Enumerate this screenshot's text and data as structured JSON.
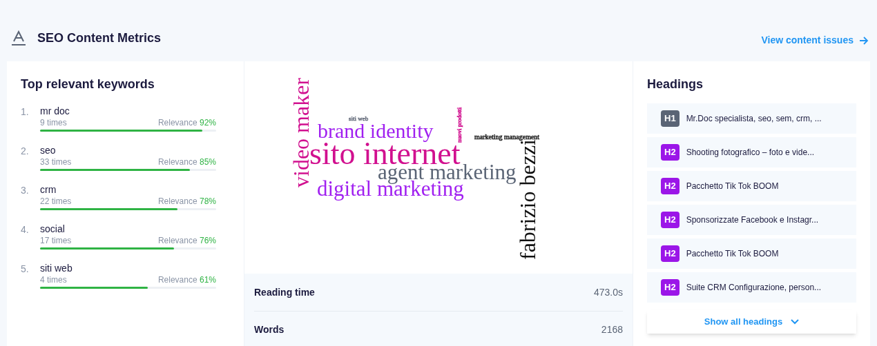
{
  "header": {
    "title": "SEO Content Metrics",
    "link": "View content issues"
  },
  "keywords": {
    "title": "Top relevant keywords",
    "items": [
      {
        "rank": "1.",
        "word": "mr doc",
        "count": "9 times",
        "label": "Relevance",
        "percent": "92%",
        "level": 0.92
      },
      {
        "rank": "2.",
        "word": "seo",
        "count": "33 times",
        "label": "Relevance",
        "percent": "85%",
        "level": 0.85
      },
      {
        "rank": "3.",
        "word": "crm",
        "count": "22 times",
        "label": "Relevance",
        "percent": "78%",
        "level": 0.78
      },
      {
        "rank": "4.",
        "word": "social",
        "count": "17 times",
        "label": "Relevance",
        "percent": "76%",
        "level": 0.76
      },
      {
        "rank": "5.",
        "word": "siti web",
        "count": "4 times",
        "label": "Relevance",
        "percent": "61%",
        "level": 0.61
      }
    ]
  },
  "word_cloud": [
    {
      "text": "video maker",
      "kind": "vertical",
      "color": "#d1108f"
    },
    {
      "text": "siti web",
      "kind": "horizontal",
      "color": "#6b7280"
    },
    {
      "text": "brand identity",
      "kind": "horizontal",
      "color": "#a020f0"
    },
    {
      "text": "nuovi prodotti",
      "kind": "vertical",
      "color": "#d1108f"
    },
    {
      "text": "marketing management",
      "kind": "horizontal",
      "color": "#222222"
    },
    {
      "text": "sito internet",
      "kind": "horizontal",
      "color": "#d1108f"
    },
    {
      "text": "agent marketing",
      "kind": "horizontal",
      "color": "#5a6475"
    },
    {
      "text": "digital marketing",
      "kind": "horizontal",
      "color": "#a020f0"
    },
    {
      "text": "fabrizio bezzi",
      "kind": "vertical",
      "color": "#111111"
    }
  ],
  "stats": [
    {
      "label": "Reading time",
      "value": "473.0s"
    },
    {
      "label": "Words",
      "value": "2168"
    }
  ],
  "headings": {
    "title": "Headings",
    "items": [
      {
        "tag": "H1",
        "text": "Mr.Doc specialista, seo, sem, crm, ...",
        "color": "#5a6475"
      },
      {
        "tag": "H2",
        "text": "Shooting fotografico – foto e vide...",
        "color": "#9b16e8"
      },
      {
        "tag": "H2",
        "text": "Pacchetto Tik Tok BOOM",
        "color": "#9b16e8"
      },
      {
        "tag": "H2",
        "text": "Sponsorizzate Facebook e Instagr...",
        "color": "#9b16e8"
      },
      {
        "tag": "H2",
        "text": "Pacchetto Tik Tok BOOM",
        "color": "#9b16e8"
      },
      {
        "tag": "H2",
        "text": "Suite CRM Configurazione, person...",
        "color": "#9b16e8"
      }
    ],
    "show_all": "Show all headings"
  }
}
